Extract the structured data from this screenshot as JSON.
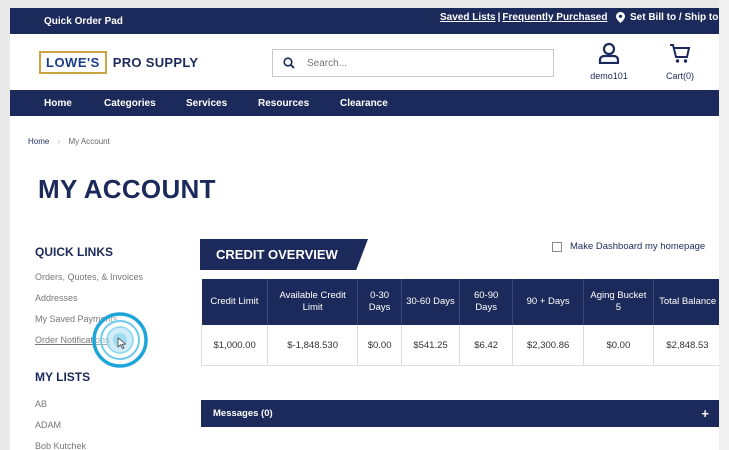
{
  "topbar": {
    "quick_order": "Quick Order Pad",
    "saved_lists": "Saved Lists",
    "separator": "|",
    "frequently_purchased": "Frequently Purchased",
    "ship_to": "Set Bill to / Ship to"
  },
  "header": {
    "logo_brand": "LOWE'S",
    "logo_sub": "PRO SUPPLY",
    "search_placeholder": "Search...",
    "user_label": "demo101",
    "cart_label": "Cart(0)"
  },
  "nav": {
    "items": [
      "Home",
      "Categories",
      "Services",
      "Resources",
      "Clearance"
    ]
  },
  "breadcrumb": {
    "home": "Home",
    "current": "My Account"
  },
  "page_title": "MY ACCOUNT",
  "quick_links": {
    "heading": "QUICK LINKS",
    "items": [
      "Orders, Quotes, & Invoices",
      "Addresses",
      "My Saved Payments",
      "Order Notifications"
    ]
  },
  "my_lists": {
    "heading": "MY LISTS",
    "items": [
      "AB",
      "ADAM",
      "Bob Kutchek"
    ]
  },
  "credit_overview": {
    "title": "CREDIT OVERVIEW",
    "dashboard_label": "Make Dashboard my homepage",
    "columns": [
      "Credit Limit",
      "Available Credit Limit",
      "0-30 Days",
      "30-60 Days",
      "60-90 Days",
      "90 + Days",
      "Aging Bucket 5",
      "Total Balance"
    ],
    "values": [
      "$1,000.00",
      "$-1,848.530",
      "$0.00",
      "$541.25",
      "$6.42",
      "$2,300.86",
      "$0.00",
      "$2,848.53"
    ]
  },
  "messages": {
    "label": "Messages (0)",
    "expand": "+"
  },
  "colors": {
    "navy": "#1b2a5a",
    "accent_cyan": "#1ea5d8",
    "logo_gold": "#c9a441"
  }
}
